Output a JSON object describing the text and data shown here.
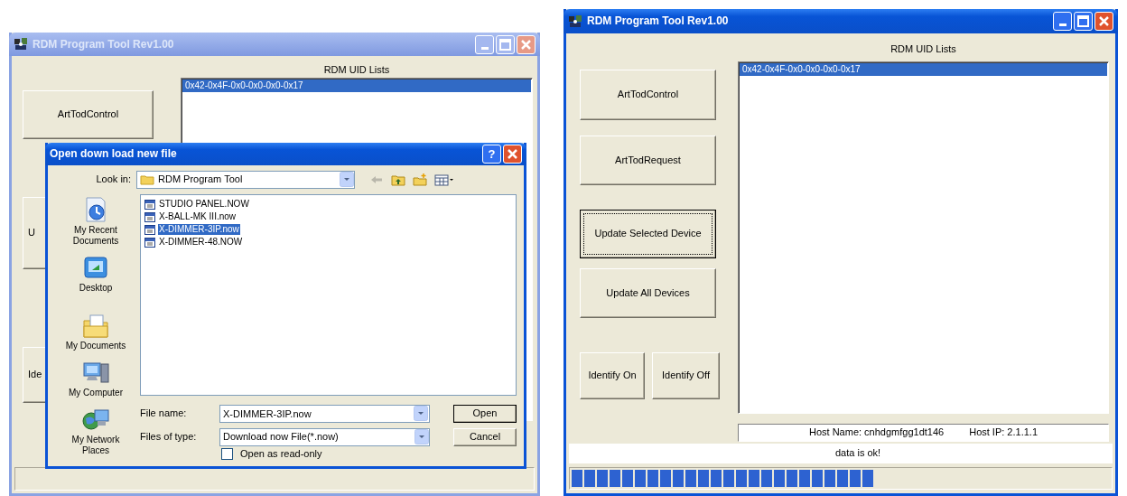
{
  "left_window": {
    "title": "RDM Program Tool Rev1.00",
    "active": false,
    "list_heading": "RDM UID Lists",
    "uid_list": [
      {
        "text": "0x42-0x4F-0x0-0x0-0x0-0x17",
        "selected": true
      }
    ],
    "buttons": [
      {
        "label": "ArtTodControl",
        "kind": "full",
        "focused": false
      },
      {
        "label": "U",
        "kind": "covered",
        "focused": false
      },
      {
        "label": "Ide",
        "kind": "covered",
        "focused": false
      }
    ],
    "dialog": {
      "title": "Open down load new file",
      "active": true,
      "help": "?",
      "look_in": {
        "label": "Look in:",
        "value": "RDM Program Tool"
      },
      "places": [
        {
          "label": "My Recent Documents"
        },
        {
          "label": "Desktop"
        },
        {
          "label": "My Documents"
        },
        {
          "label": "My Computer"
        },
        {
          "label": "My Network Places"
        }
      ],
      "files": [
        {
          "name": "STUDIO PANEL.NOW",
          "selected": false
        },
        {
          "name": "X-BALL-MK III.now",
          "selected": false
        },
        {
          "name": "X-DIMMER-3IP.now",
          "selected": true
        },
        {
          "name": "X-DIMMER-48.NOW",
          "selected": false
        }
      ],
      "file_name": {
        "label": "File name:",
        "value": "X-DIMMER-3IP.now"
      },
      "file_type": {
        "label": "Files of type:",
        "value": "Download now File(*.now)"
      },
      "read_only": {
        "label": "Open as read-only",
        "checked": false
      },
      "buttons": [
        {
          "label": "Open",
          "kind": "default"
        },
        {
          "label": "Cancel",
          "kind": "normal"
        }
      ]
    }
  },
  "right_window": {
    "title": "RDM Program Tool Rev1.00",
    "active": true,
    "list_heading": "RDM UID Lists",
    "uid_list": [
      {
        "text": "0x42-0x4F-0x0-0x0-0x0-0x17",
        "selected": true
      }
    ],
    "buttons": [
      {
        "label": "ArtTodControl",
        "focused": false
      },
      {
        "label": "ArtTodRequest",
        "focused": false
      },
      {
        "label": "Update Selected Device",
        "focused": true
      },
      {
        "label": "Update All Devices",
        "focused": false
      }
    ],
    "identify_buttons": [
      {
        "label": "Identify On",
        "focused": false
      },
      {
        "label": "Identify Off",
        "focused": false
      }
    ],
    "host_name": "Host Name: cnhdgmfgg1dt146",
    "host_ip": "Host IP: 2.1.1.1",
    "status": "data is ok!",
    "progress": {
      "level": 0.56
    }
  }
}
